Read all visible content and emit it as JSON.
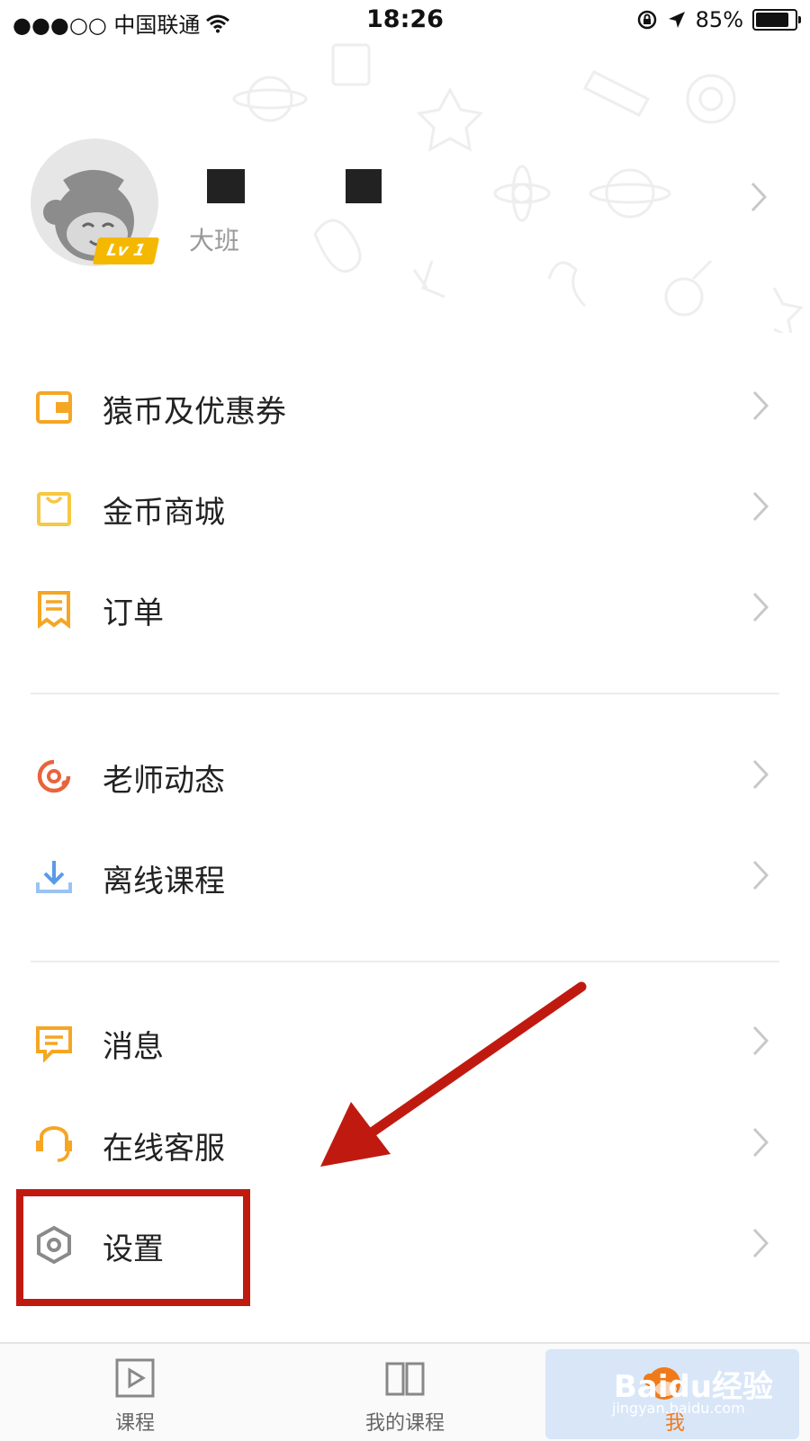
{
  "status_bar": {
    "carrier": "●●●○○ 中国联通",
    "time": "18:26",
    "battery": "85%",
    "battery_level": 0.85
  },
  "profile": {
    "level_badge": "Lv 1",
    "grade": "大班"
  },
  "menu": {
    "section1": [
      {
        "label": "猿币及优惠券",
        "icon": "wallet-icon",
        "color": "#f5a623"
      },
      {
        "label": "金币商城",
        "icon": "shopping-bag-icon",
        "color": "#f7c843"
      },
      {
        "label": "订单",
        "icon": "receipt-icon",
        "color": "#f5a623"
      }
    ],
    "section2": [
      {
        "label": "老师动态",
        "icon": "teacher-feed-icon",
        "color": "#e8643c"
      },
      {
        "label": "离线课程",
        "icon": "download-icon",
        "color": "#5a9be8"
      }
    ],
    "section3": [
      {
        "label": "消息",
        "icon": "message-icon",
        "color": "#f5a623"
      },
      {
        "label": "在线客服",
        "icon": "headset-icon",
        "color": "#f5a623"
      },
      {
        "label": "设置",
        "icon": "settings-hexagon-icon",
        "color": "#8a8a8a"
      }
    ]
  },
  "tabbar": {
    "tabs": [
      {
        "label": "课程",
        "icon": "play-icon"
      },
      {
        "label": "我的课程",
        "icon": "book-icon"
      },
      {
        "label": "我",
        "icon": "monkey-avatar-icon",
        "active": true
      }
    ]
  },
  "watermark": {
    "text": "Baidu经验",
    "sub": "jingyan.baidu.com"
  },
  "colors": {
    "accent": "#f5a623",
    "annotation_red": "#c01a10"
  }
}
